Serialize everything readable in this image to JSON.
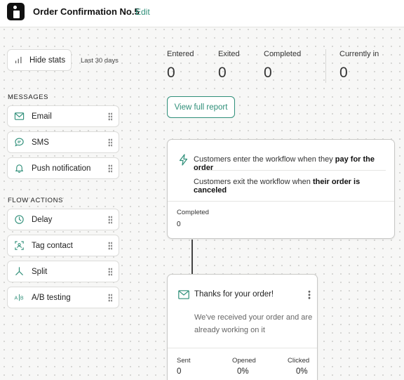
{
  "header": {
    "title": "Order Confirmation No.5",
    "edit_label": "Edit"
  },
  "sidebar": {
    "hide_stats_label": "Hide stats",
    "period_label": "Last 30 days",
    "messages_heading": "MESSAGES",
    "messages": [
      {
        "label": "Email",
        "icon": "mail-icon"
      },
      {
        "label": "SMS",
        "icon": "chat-bubble-icon"
      },
      {
        "label": "Push notification",
        "icon": "bell-icon"
      }
    ],
    "flow_actions_heading": "FLOW ACTIONS",
    "flow_actions": [
      {
        "label": "Delay",
        "icon": "clock-icon"
      },
      {
        "label": "Tag contact",
        "icon": "tag-contact-icon"
      },
      {
        "label": "Split",
        "icon": "split-icon"
      },
      {
        "label": "A/B testing",
        "icon": "ab-icon"
      }
    ]
  },
  "stats": {
    "entered_label": "Entered",
    "entered_value": "0",
    "exited_label": "Exited",
    "exited_value": "0",
    "completed_label": "Completed",
    "completed_value": "0",
    "current_label": "Currently in",
    "current_value": "0"
  },
  "report_button_label": "View full report",
  "trigger": {
    "enter_prefix": "Customers enter the workflow when they ",
    "enter_bold": "pay for the order",
    "exit_prefix": "Customers exit the workflow when ",
    "exit_bold": "their order is canceled",
    "completed_label": "Completed",
    "completed_value": "0"
  },
  "email_step": {
    "title": "Thanks for your order!",
    "body": "We've received your order and are already working on it",
    "sent_label": "Sent",
    "sent_value": "0",
    "opened_label": "Opened",
    "opened_value": "0%",
    "clicked_label": "Clicked",
    "clicked_value": "0%"
  },
  "colors": {
    "accent": "#2f8f79",
    "background": "#f7f7f6"
  }
}
